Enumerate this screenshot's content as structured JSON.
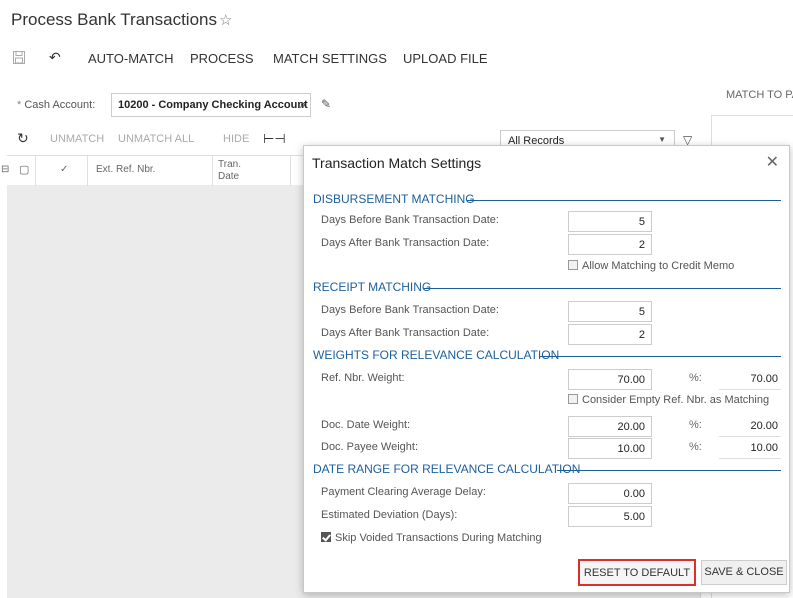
{
  "header": {
    "title": "Process Bank Transactions",
    "star_icon": "star-outline-icon"
  },
  "toolbar": {
    "save_icon": "save-icon",
    "undo_icon": "undo-icon",
    "auto_match": "AUTO-MATCH",
    "process": "PROCESS",
    "match_settings": "MATCH SETTINGS",
    "upload_file": "UPLOAD FILE"
  },
  "filter": {
    "cash_account_label": "Cash Account:",
    "cash_account_value": "10200 - Company Checking Account",
    "records_value": "All Records"
  },
  "grid_toolbar": {
    "unmatch": "UNMATCH",
    "unmatch_all": "UNMATCH ALL",
    "hide": "HIDE"
  },
  "grid": {
    "columns": [
      "Ext. Ref. Nbr.",
      "Tran.",
      "Date"
    ]
  },
  "right_panel": {
    "title": "MATCH TO PA"
  },
  "dialog": {
    "title": "Transaction Match Settings",
    "disbursement": {
      "heading": "DISBURSEMENT MATCHING",
      "days_before_label": "Days Before Bank Transaction Date:",
      "days_before_value": "5",
      "days_after_label": "Days After Bank Transaction Date:",
      "days_after_value": "2",
      "credit_memo_label": "Allow Matching to Credit Memo"
    },
    "receipt": {
      "heading": "RECEIPT MATCHING",
      "days_before_label": "Days Before Bank Transaction Date:",
      "days_before_value": "5",
      "days_after_label": "Days After Bank Transaction Date:",
      "days_after_value": "2"
    },
    "weights": {
      "heading": "WEIGHTS FOR RELEVANCE CALCULATION",
      "ref_label": "Ref. Nbr. Weight:",
      "ref_value": "70.00",
      "ref_pct": "70.00",
      "pct_label": "%:",
      "empty_ref_label": "Consider Empty Ref. Nbr. as Matching",
      "date_label": "Doc. Date Weight:",
      "date_value": "20.00",
      "date_pct": "20.00",
      "payee_label": "Doc. Payee Weight:",
      "payee_value": "10.00",
      "payee_pct": "10.00"
    },
    "date_range": {
      "heading": "DATE RANGE FOR RELEVANCE CALCULATION",
      "delay_label": "Payment Clearing Average Delay:",
      "delay_value": "0.00",
      "deviation_label": "Estimated Deviation (Days):",
      "deviation_value": "5.00",
      "skip_label": "Skip Voided Transactions During Matching"
    },
    "reset_button": "RESET TO DEFAULT",
    "save_button": "SAVE & CLOSE"
  }
}
